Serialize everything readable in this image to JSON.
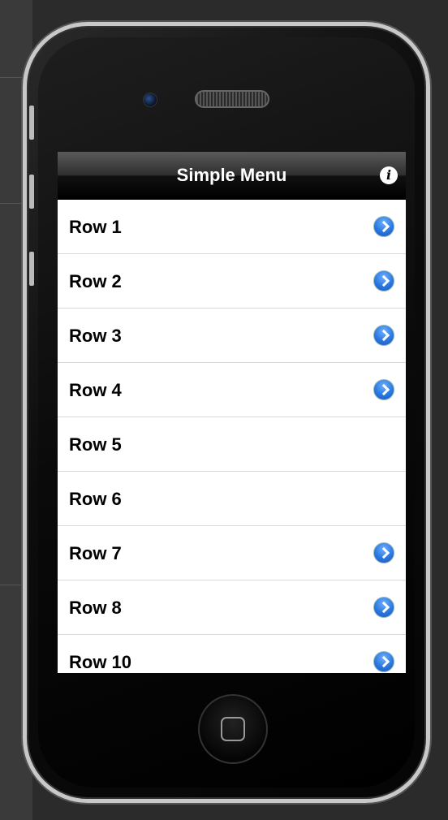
{
  "nav": {
    "title": "Simple Menu",
    "info_icon": "info-icon"
  },
  "rows": [
    {
      "label": "Row 1",
      "disclosure": true
    },
    {
      "label": "Row 2",
      "disclosure": true
    },
    {
      "label": "Row 3",
      "disclosure": true
    },
    {
      "label": "Row 4",
      "disclosure": true
    },
    {
      "label": "Row 5",
      "disclosure": false
    },
    {
      "label": "Row 6",
      "disclosure": false
    },
    {
      "label": "Row 7",
      "disclosure": true
    },
    {
      "label": "Row 8",
      "disclosure": true
    },
    {
      "label": "Row 10",
      "disclosure": true
    }
  ],
  "colors": {
    "disclosure_accent": "#2a78e0",
    "navbar": "#000000"
  }
}
